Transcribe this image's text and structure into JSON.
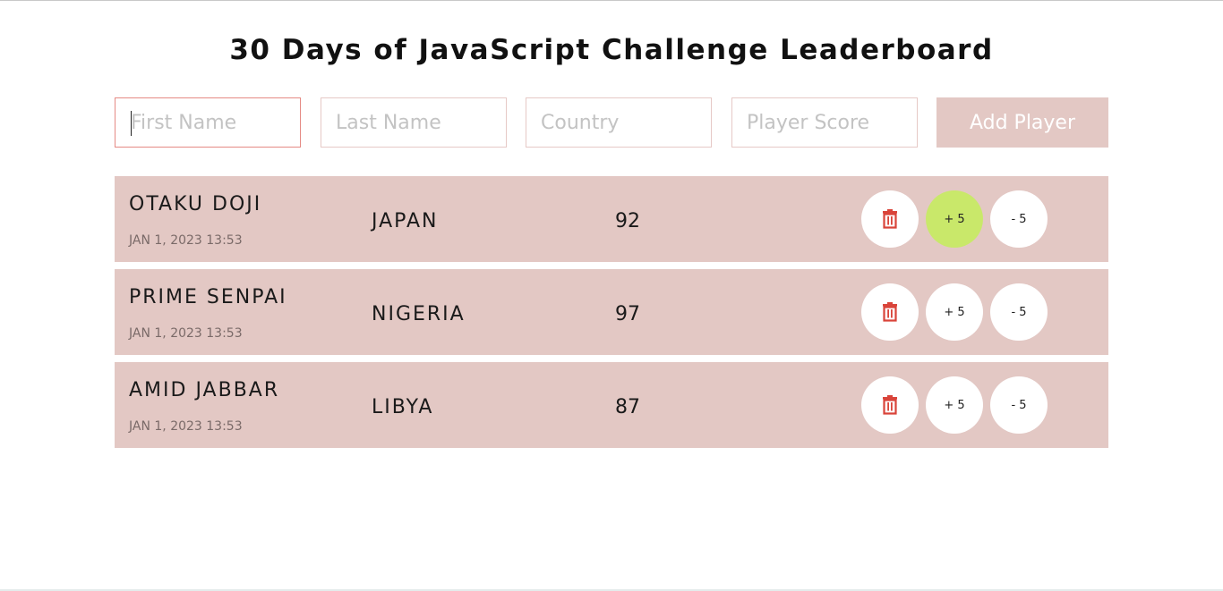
{
  "title": "30 Days of JavaScript Challenge Leaderboard",
  "form": {
    "first_name_placeholder": "First Name",
    "last_name_placeholder": "Last Name",
    "country_placeholder": "Country",
    "score_placeholder": "Player Score",
    "add_label": "Add Player"
  },
  "players": [
    {
      "name": "OTAKU DOJI",
      "date": "JAN 1, 2023 13:53",
      "country": "JAPAN",
      "score": "92",
      "delete_icon": "trash-icon",
      "plus_label": "+ 5",
      "minus_label": "- 5"
    },
    {
      "name": "PRIME SENPAI",
      "date": "JAN 1, 2023 13:53",
      "country": "NIGERIA",
      "score": "97",
      "delete_icon": "trash-icon",
      "plus_label": "+ 5",
      "minus_label": "- 5"
    },
    {
      "name": "AMID JABBAR",
      "date": "JAN 1, 2023 13:53",
      "country": "LIBYA",
      "score": "87",
      "delete_icon": "trash-icon",
      "plus_label": "+ 5",
      "minus_label": "- 5"
    }
  ],
  "colors": {
    "row_background": "#e3c8c4",
    "button_background": "#e3c8c4",
    "plus_hover": "#c9e86a",
    "delete_icon": "#d9443a",
    "focus_border": "#e58a84"
  }
}
